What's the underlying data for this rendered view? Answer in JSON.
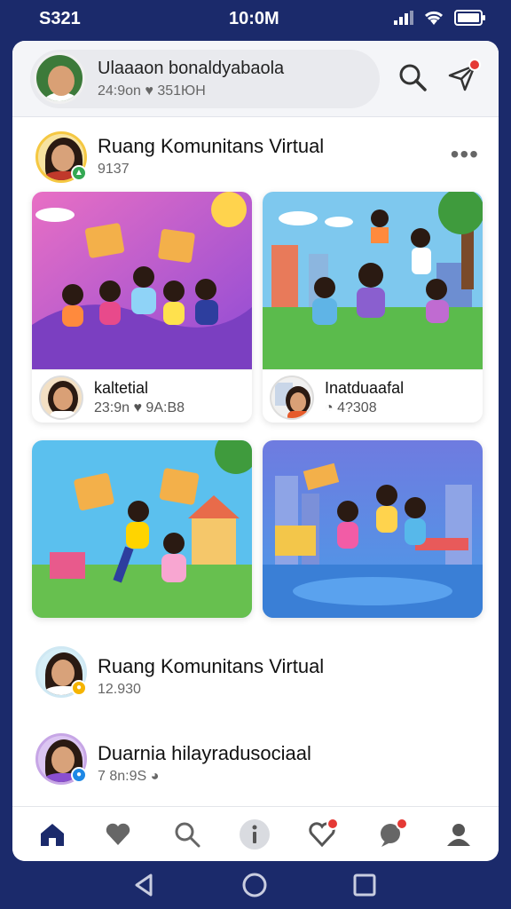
{
  "status_bar": {
    "left": "S321",
    "time": "10:0M"
  },
  "header": {
    "user_name": "Ulaaaon bonaldyabaola",
    "user_meta": "24:9on  ♥ 351ЮН",
    "search_icon": "search-icon",
    "send_icon": "send-icon"
  },
  "feed": {
    "post1": {
      "title": "Ruang Komunitans Virtual",
      "meta": "9137"
    },
    "tiles": [
      {
        "title": "kaltetial",
        "meta": "23:9n  ♥ 9A:B8"
      },
      {
        "title": "Inatduaafal",
        "meta": "◔ 4?308"
      }
    ],
    "post2": {
      "title": "Ruang Komunitans Virtual",
      "meta": "12.930"
    },
    "post3": {
      "title": "Duarnia hilayradusociaal",
      "meta": "7 8n:9S ◕"
    }
  },
  "bottom_nav": {
    "items": [
      "home-icon",
      "heart-icon",
      "search-icon",
      "info-icon",
      "favorites-icon",
      "chat-icon",
      "profile-icon"
    ]
  },
  "colors": {
    "accent": "#1b2a6b",
    "badge": "#e53935"
  }
}
